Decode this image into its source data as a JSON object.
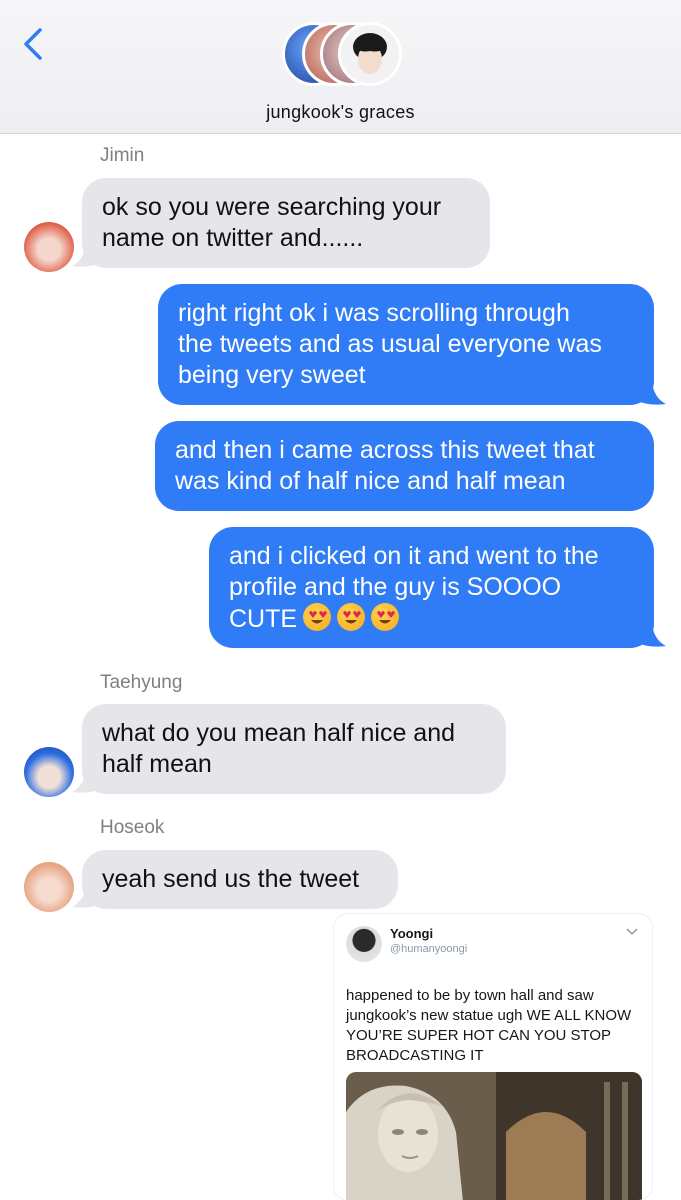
{
  "header": {
    "back_icon": "chevron-left-icon",
    "group_name": "jungkook's graces",
    "accent": "#2f7cf6"
  },
  "messages": [
    {
      "type": "incoming",
      "sender": "Jimin",
      "lines": [
        "ok so you were searching your",
        "name on twitter and......"
      ]
    },
    {
      "type": "outgoing",
      "lines": [
        "right right ok i was scrolling through",
        "the tweets and as usual everyone was",
        "being very sweet"
      ]
    },
    {
      "type": "outgoing",
      "lines": [
        "and then i came across this tweet that",
        "was kind of half nice and half mean"
      ]
    },
    {
      "type": "outgoing",
      "lines": [
        "and i clicked on it and went to the",
        "profile and the guy is SOOOO",
        "CUTE"
      ],
      "emoji": [
        "heart-eyes-emoji",
        "heart-eyes-emoji",
        "heart-eyes-emoji"
      ]
    },
    {
      "type": "incoming",
      "sender": "Taehyung",
      "lines": [
        "what do you mean half nice and",
        "half mean"
      ]
    },
    {
      "type": "incoming",
      "sender": "Hoseok",
      "lines": [
        "yeah send us the tweet"
      ]
    }
  ],
  "tweet": {
    "name": "Yoongi",
    "handle": "@humanyoongi",
    "text": "happened to be by town hall and saw jungkook’s new statue ugh WE ALL KNOW YOU’RE SUPER HOT CAN YOU STOP BROADCASTING IT",
    "image": "statue-photo"
  },
  "colors": {
    "incoming_bubble": "#e5e5ea",
    "outgoing_bubble": "#2f7cf6",
    "sender_name": "#7f7f84"
  }
}
